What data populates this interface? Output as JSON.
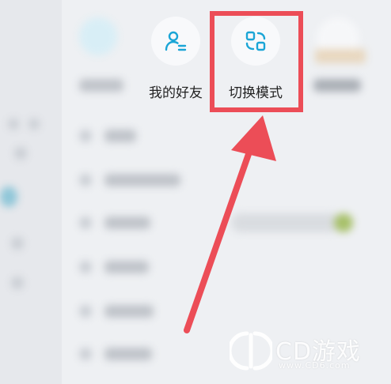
{
  "quick_actions": [
    {
      "label": "我的好友",
      "icon": "person-list-icon"
    },
    {
      "label": "切换模式",
      "icon": "switch-mode-icon"
    }
  ],
  "watermark": {
    "brand": "CD游戏",
    "url": "www.CD6.com"
  },
  "colors": {
    "accent": "#1aa5d6",
    "highlight": "#ec4d57",
    "background": "#eef0f3"
  }
}
